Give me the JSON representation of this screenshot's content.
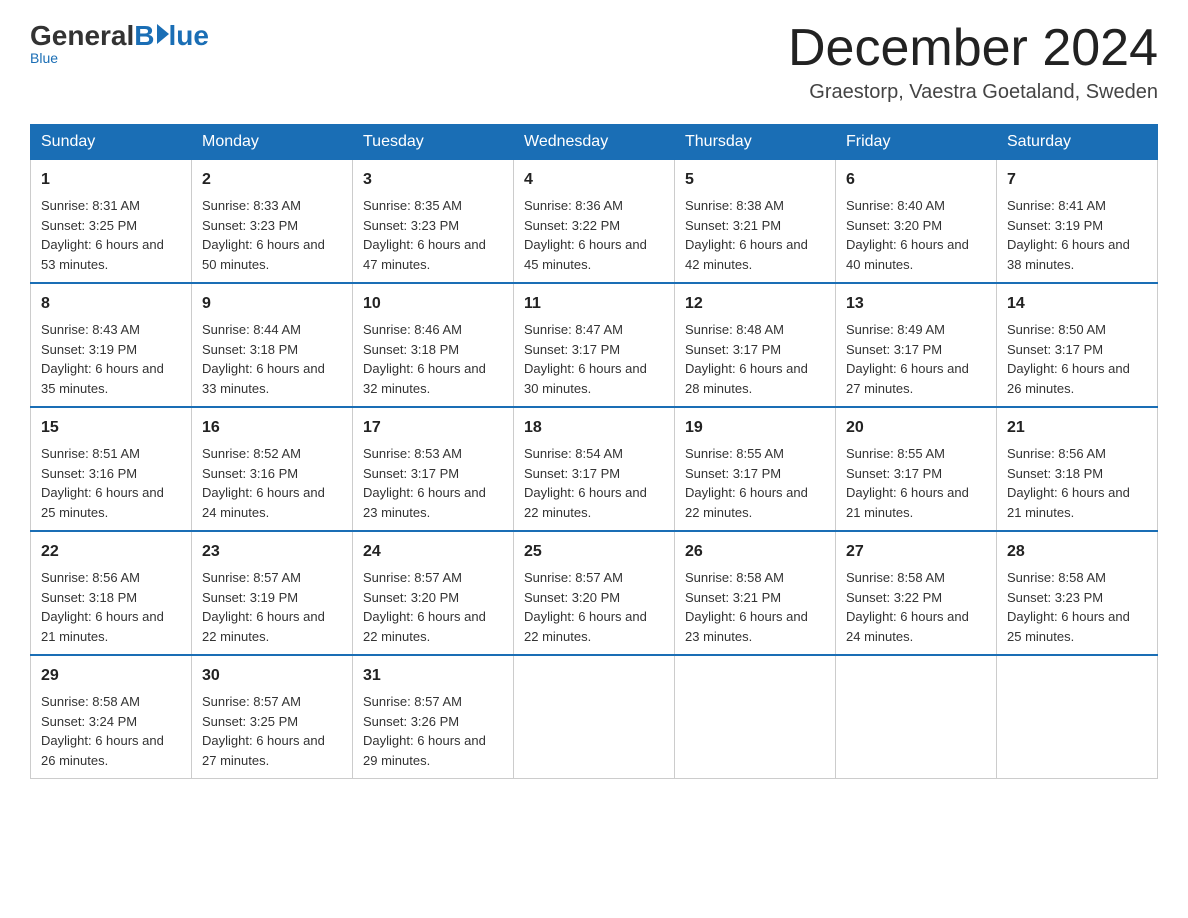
{
  "logo": {
    "general": "General",
    "blue": "Blue",
    "tagline": "Blue"
  },
  "header": {
    "title": "December 2024",
    "location": "Graestorp, Vaestra Goetaland, Sweden"
  },
  "weekdays": [
    "Sunday",
    "Monday",
    "Tuesday",
    "Wednesday",
    "Thursday",
    "Friday",
    "Saturday"
  ],
  "weeks": [
    [
      {
        "day": "1",
        "sunrise": "8:31 AM",
        "sunset": "3:25 PM",
        "daylight": "6 hours and 53 minutes."
      },
      {
        "day": "2",
        "sunrise": "8:33 AM",
        "sunset": "3:23 PM",
        "daylight": "6 hours and 50 minutes."
      },
      {
        "day": "3",
        "sunrise": "8:35 AM",
        "sunset": "3:23 PM",
        "daylight": "6 hours and 47 minutes."
      },
      {
        "day": "4",
        "sunrise": "8:36 AM",
        "sunset": "3:22 PM",
        "daylight": "6 hours and 45 minutes."
      },
      {
        "day": "5",
        "sunrise": "8:38 AM",
        "sunset": "3:21 PM",
        "daylight": "6 hours and 42 minutes."
      },
      {
        "day": "6",
        "sunrise": "8:40 AM",
        "sunset": "3:20 PM",
        "daylight": "6 hours and 40 minutes."
      },
      {
        "day": "7",
        "sunrise": "8:41 AM",
        "sunset": "3:19 PM",
        "daylight": "6 hours and 38 minutes."
      }
    ],
    [
      {
        "day": "8",
        "sunrise": "8:43 AM",
        "sunset": "3:19 PM",
        "daylight": "6 hours and 35 minutes."
      },
      {
        "day": "9",
        "sunrise": "8:44 AM",
        "sunset": "3:18 PM",
        "daylight": "6 hours and 33 minutes."
      },
      {
        "day": "10",
        "sunrise": "8:46 AM",
        "sunset": "3:18 PM",
        "daylight": "6 hours and 32 minutes."
      },
      {
        "day": "11",
        "sunrise": "8:47 AM",
        "sunset": "3:17 PM",
        "daylight": "6 hours and 30 minutes."
      },
      {
        "day": "12",
        "sunrise": "8:48 AM",
        "sunset": "3:17 PM",
        "daylight": "6 hours and 28 minutes."
      },
      {
        "day": "13",
        "sunrise": "8:49 AM",
        "sunset": "3:17 PM",
        "daylight": "6 hours and 27 minutes."
      },
      {
        "day": "14",
        "sunrise": "8:50 AM",
        "sunset": "3:17 PM",
        "daylight": "6 hours and 26 minutes."
      }
    ],
    [
      {
        "day": "15",
        "sunrise": "8:51 AM",
        "sunset": "3:16 PM",
        "daylight": "6 hours and 25 minutes."
      },
      {
        "day": "16",
        "sunrise": "8:52 AM",
        "sunset": "3:16 PM",
        "daylight": "6 hours and 24 minutes."
      },
      {
        "day": "17",
        "sunrise": "8:53 AM",
        "sunset": "3:17 PM",
        "daylight": "6 hours and 23 minutes."
      },
      {
        "day": "18",
        "sunrise": "8:54 AM",
        "sunset": "3:17 PM",
        "daylight": "6 hours and 22 minutes."
      },
      {
        "day": "19",
        "sunrise": "8:55 AM",
        "sunset": "3:17 PM",
        "daylight": "6 hours and 22 minutes."
      },
      {
        "day": "20",
        "sunrise": "8:55 AM",
        "sunset": "3:17 PM",
        "daylight": "6 hours and 21 minutes."
      },
      {
        "day": "21",
        "sunrise": "8:56 AM",
        "sunset": "3:18 PM",
        "daylight": "6 hours and 21 minutes."
      }
    ],
    [
      {
        "day": "22",
        "sunrise": "8:56 AM",
        "sunset": "3:18 PM",
        "daylight": "6 hours and 21 minutes."
      },
      {
        "day": "23",
        "sunrise": "8:57 AM",
        "sunset": "3:19 PM",
        "daylight": "6 hours and 22 minutes."
      },
      {
        "day": "24",
        "sunrise": "8:57 AM",
        "sunset": "3:20 PM",
        "daylight": "6 hours and 22 minutes."
      },
      {
        "day": "25",
        "sunrise": "8:57 AM",
        "sunset": "3:20 PM",
        "daylight": "6 hours and 22 minutes."
      },
      {
        "day": "26",
        "sunrise": "8:58 AM",
        "sunset": "3:21 PM",
        "daylight": "6 hours and 23 minutes."
      },
      {
        "day": "27",
        "sunrise": "8:58 AM",
        "sunset": "3:22 PM",
        "daylight": "6 hours and 24 minutes."
      },
      {
        "day": "28",
        "sunrise": "8:58 AM",
        "sunset": "3:23 PM",
        "daylight": "6 hours and 25 minutes."
      }
    ],
    [
      {
        "day": "29",
        "sunrise": "8:58 AM",
        "sunset": "3:24 PM",
        "daylight": "6 hours and 26 minutes."
      },
      {
        "day": "30",
        "sunrise": "8:57 AM",
        "sunset": "3:25 PM",
        "daylight": "6 hours and 27 minutes."
      },
      {
        "day": "31",
        "sunrise": "8:57 AM",
        "sunset": "3:26 PM",
        "daylight": "6 hours and 29 minutes."
      },
      null,
      null,
      null,
      null
    ]
  ],
  "labels": {
    "sunrise": "Sunrise: ",
    "sunset": "Sunset: ",
    "daylight": "Daylight: "
  }
}
